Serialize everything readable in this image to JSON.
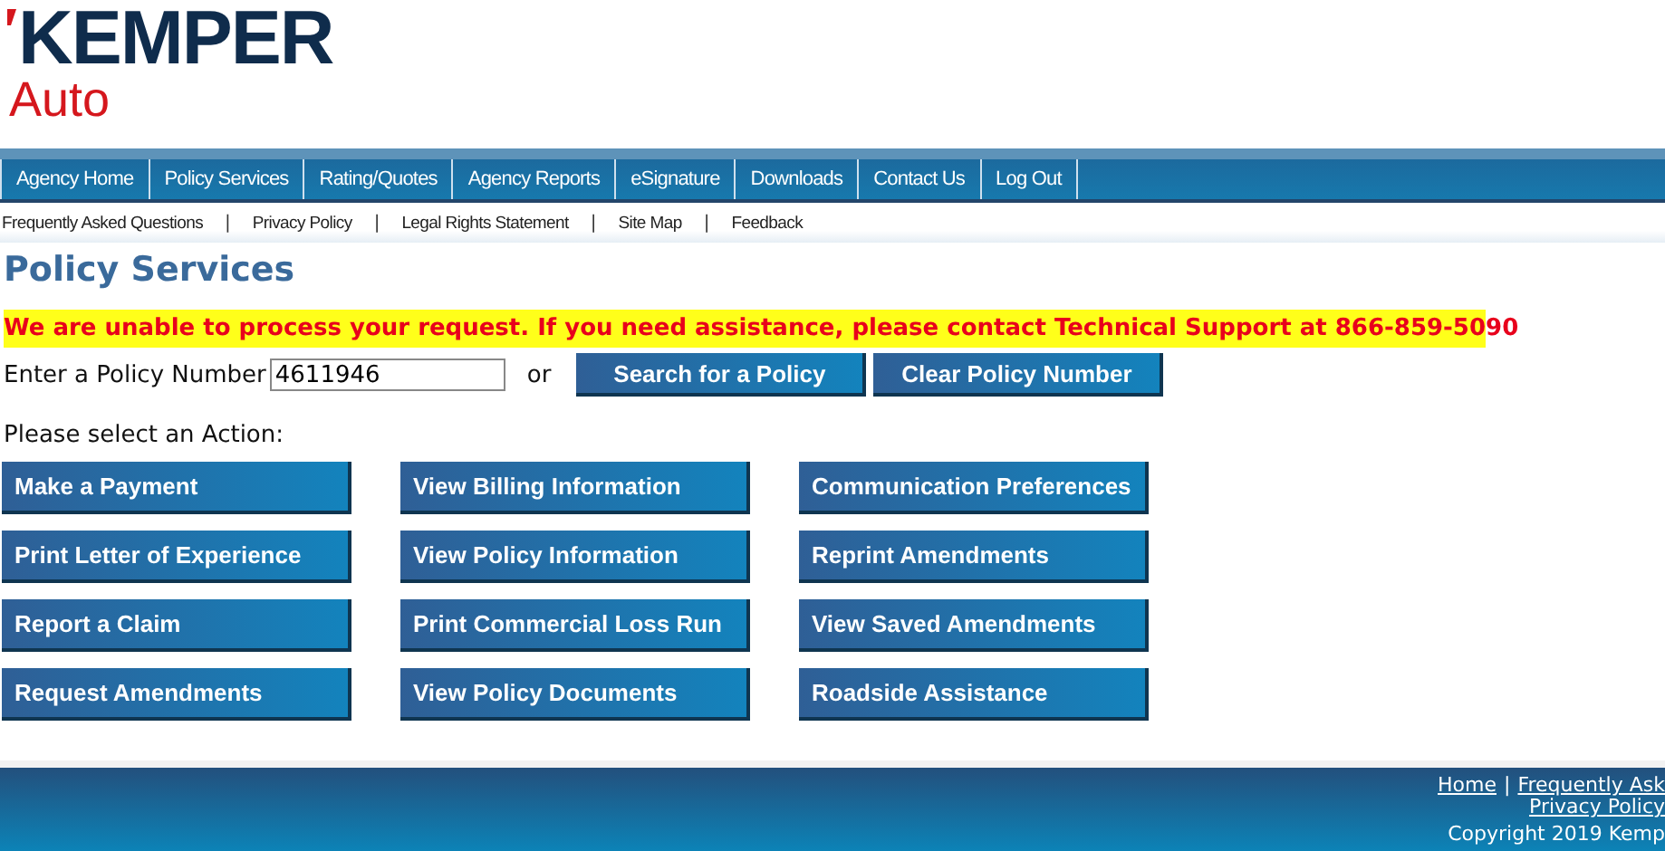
{
  "logo": {
    "brand": "KEMPER",
    "product": "Auto"
  },
  "nav": [
    {
      "label": "Agency Home",
      "selected": false
    },
    {
      "label": "Policy Services",
      "selected": false
    },
    {
      "label": "Rating/Quotes",
      "selected": false
    },
    {
      "label": "Agency Reports",
      "selected": false
    },
    {
      "label": "eSignature",
      "selected": false
    },
    {
      "label": "Downloads",
      "selected": false
    },
    {
      "label": "Contact Us",
      "selected": false
    },
    {
      "label": "Log Out",
      "selected": false
    }
  ],
  "sub_links": [
    "Frequently Asked Questions",
    "Privacy Policy",
    "Legal Rights Statement",
    "Site Map",
    "Feedback"
  ],
  "sub_separator": "|",
  "page_title": "Policy Services",
  "error": {
    "highlighted": "We are unable to process your request. If you need assistance, please contact Technical Support at 866-859-50",
    "rest": "90"
  },
  "policy": {
    "label": "Enter a Policy Number",
    "value": "4611946",
    "or": "or",
    "buttons": [
      "Search for a Policy",
      "Clear Policy Number"
    ]
  },
  "action_prompt": "Please select an Action:",
  "actions": [
    [
      "Make a Payment",
      "View Billing Information",
      "Communication Preferences"
    ],
    [
      "Print Letter of Experience",
      "View Policy Information",
      "Reprint Amendments"
    ],
    [
      "Report a Claim",
      "Print Commercial Loss Run",
      "View Saved Amendments"
    ],
    [
      "Request Amendments",
      "View Policy Documents",
      "Roadside Assistance"
    ]
  ],
  "footer": {
    "links": [
      "Home",
      "Frequently Ask"
    ],
    "separator": "|",
    "link_2": "Privacy Policy",
    "copyright": "Copyright 2019 Kemp"
  }
}
